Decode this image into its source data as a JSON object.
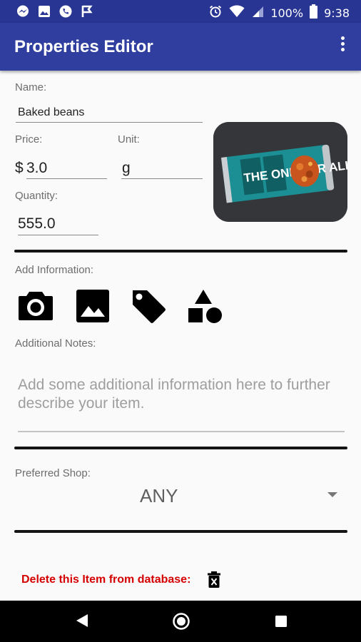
{
  "status_bar": {
    "notifications": [
      "messenger-icon",
      "image-icon",
      "phone-icon",
      "flag-icon"
    ],
    "battery": "100%",
    "time": "9:38"
  },
  "app_bar": {
    "title": "Properties Editor"
  },
  "form": {
    "name_label": "Name:",
    "name_value": "Baked beans",
    "price_label": "Price:",
    "currency_symbol": "$",
    "price_value": "3.0",
    "unit_label": "Unit:",
    "unit_value": "g",
    "quantity_label": "Quantity:",
    "quantity_value": "555.0"
  },
  "photo_label": "THE ONE FOR ALL",
  "add_info": {
    "label": "Add Information:",
    "buttons": [
      "camera-icon",
      "gallery-icon",
      "tag-icon",
      "category-icon"
    ]
  },
  "notes": {
    "label": "Additional Notes:",
    "placeholder": "Add some additional information here to further describe your item."
  },
  "shop": {
    "label": "Preferred Shop:",
    "selected": "ANY"
  },
  "delete": {
    "label": "Delete this Item from database:"
  },
  "colors": {
    "primary_dark": "#283593",
    "primary": "#303f9f",
    "delete_red": "#d50000"
  }
}
